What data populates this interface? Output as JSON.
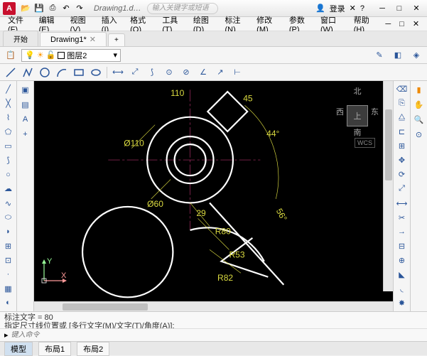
{
  "title": {
    "app_initial": "A",
    "document": "Drawing1.d…",
    "search_placeholder": "输入关键字或短语",
    "login": "登录"
  },
  "menu": {
    "file": "文件(F)",
    "edit": "编辑(E)",
    "view": "视图(V)",
    "insert": "插入(I)",
    "format": "格式(O)",
    "tools": "工具(T)",
    "draw": "绘图(D)",
    "dimension": "标注(N)",
    "modify": "修改(M)",
    "parametric": "参数(P)",
    "window": "窗口(W)",
    "help": "帮助(H)"
  },
  "doctabs": {
    "start": "开始",
    "drawing": "Drawing1*",
    "add": "+"
  },
  "layer": {
    "current": "图层2"
  },
  "viewcube": {
    "n": "北",
    "s": "南",
    "e": "东",
    "w": "西",
    "top": "上",
    "wcs": "WCS"
  },
  "dims": {
    "d110": "Ø110",
    "d60": "Ø60",
    "l110": "110",
    "l45": "45",
    "a44": "44°",
    "a56": "56°",
    "l29": "29",
    "r80": "R80",
    "r53": "R53",
    "r82": "R82"
  },
  "ucs": {
    "x": "X",
    "y": "Y"
  },
  "cmd": {
    "hist1": "标注文字 = 80",
    "hist2": "指定尺寸线位置或 [多行文字(M)/文字(T)/角度(A)]:",
    "prompt_icon": "▸",
    "placeholder": "键入命令"
  },
  "status": {
    "model": "模型",
    "layout1": "布局1",
    "layout2": "布局2"
  }
}
